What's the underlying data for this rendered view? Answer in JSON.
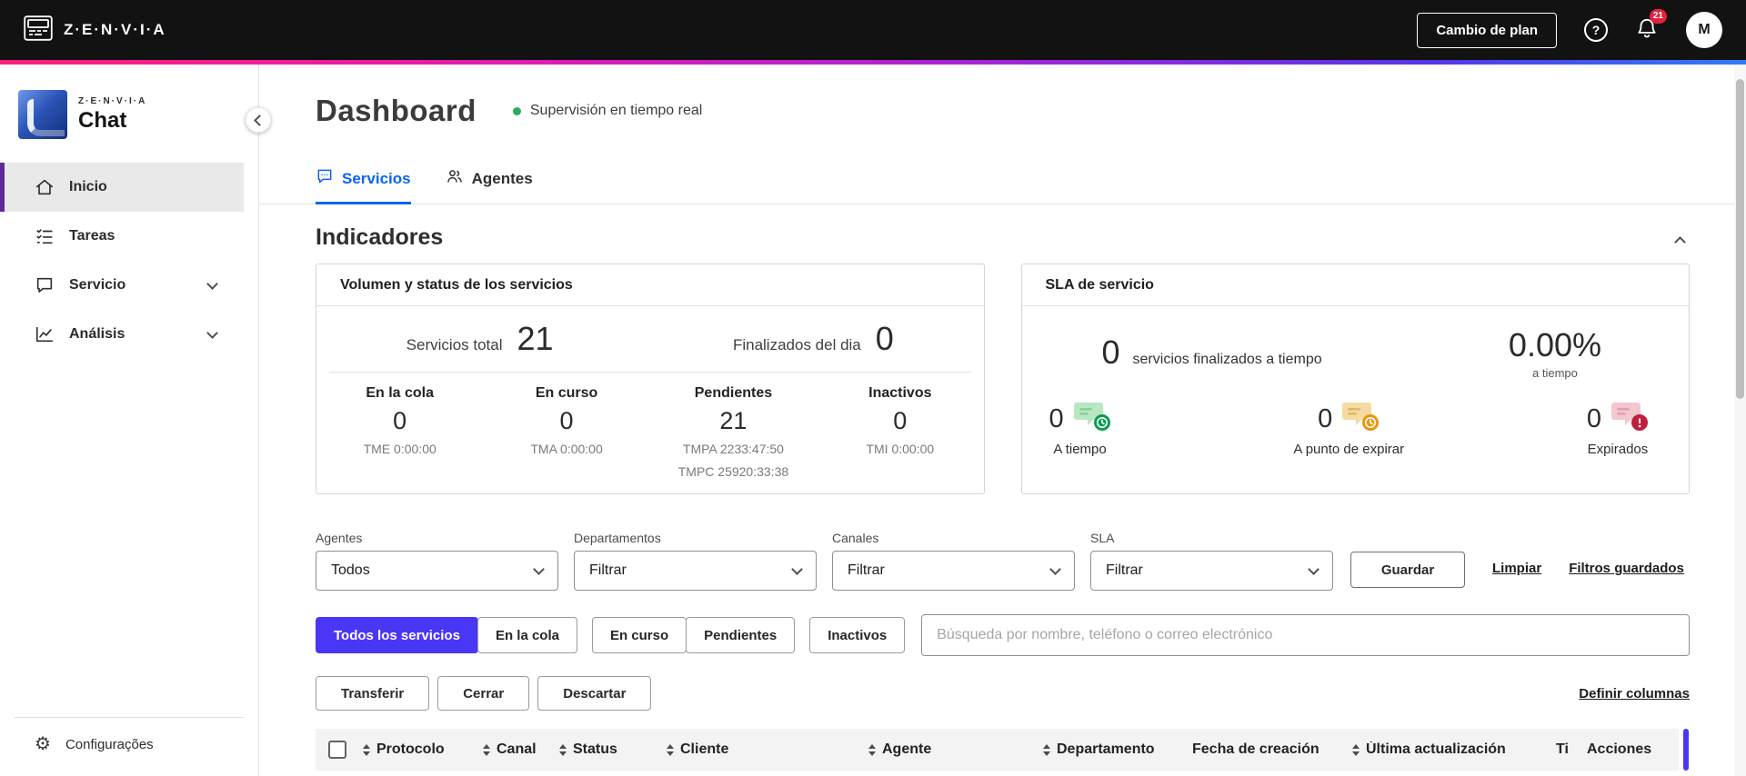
{
  "colors": {
    "accent_purple": "#4a36f5",
    "active_tab_blue": "#0b63f3",
    "sidebar_active_purple": "#5e2b97",
    "realtime_green": "#27ae60",
    "sla_ontime_green": "#0a9d4e",
    "sla_expiring_orange": "#e8960f",
    "sla_expired_red": "#bf1f3f",
    "notification_red": "#e4213f"
  },
  "icons": {
    "help": "?",
    "gear": "⚙"
  },
  "topbar": {
    "brand": "Z·E·N·V·I·A",
    "change_plan_label": "Cambio de plan",
    "notification_count": "21",
    "avatar_initial": "M"
  },
  "sidebar": {
    "logo_brand": "Z·E·N·V·I·A",
    "logo_product": "Chat",
    "items": [
      {
        "label": "Inicio"
      },
      {
        "label": "Tareas"
      },
      {
        "label": "Servicio"
      },
      {
        "label": "Análisis"
      }
    ],
    "footer_item": "Configurações"
  },
  "header": {
    "title": "Dashboard",
    "status_text": "Supervisión en tiempo real"
  },
  "tabs": [
    {
      "label": "Servicios"
    },
    {
      "label": "Agentes"
    }
  ],
  "indicators": {
    "section_title": "Indicadores",
    "volume_card": {
      "title": "Volumen y status de los servicios",
      "totals": [
        {
          "label": "Servicios total",
          "value": "21"
        },
        {
          "label": "Finalizados del dia",
          "value": "0"
        }
      ],
      "stats": [
        {
          "label": "En la cola",
          "value": "0",
          "sub1": "TME 0:00:00",
          "sub2": ""
        },
        {
          "label": "En curso",
          "value": "0",
          "sub1": "TMA 0:00:00",
          "sub2": ""
        },
        {
          "label": "Pendientes",
          "value": "21",
          "sub1": "TMPA 2233:47:50",
          "sub2": "TMPC 25920:33:38"
        },
        {
          "label": "Inactivos",
          "value": "0",
          "sub1": "TMI 0:00:00",
          "sub2": ""
        }
      ]
    },
    "sla_card": {
      "title": "SLA de servicio",
      "finalized_value": "0",
      "finalized_label": "servicios finalizados a tiempo",
      "percent_value": "0.00%",
      "percent_label": "a tiempo",
      "stats": [
        {
          "value": "0",
          "label": "A tiempo"
        },
        {
          "value": "0",
          "label": "A punto de expirar"
        },
        {
          "value": "0",
          "label": "Expirados"
        }
      ]
    }
  },
  "filters": {
    "fields": [
      {
        "label": "Agentes",
        "value": "Todos"
      },
      {
        "label": "Departamentos",
        "value": "Filtrar"
      },
      {
        "label": "Canales",
        "value": "Filtrar"
      },
      {
        "label": "SLA",
        "value": "Filtrar"
      }
    ],
    "save_label": "Guardar",
    "clear_label": "Limpiar",
    "saved_label": "Filtros guardados"
  },
  "service_tabs": [
    {
      "label": "Todos los servicios"
    },
    {
      "label": "En la cola"
    },
    {
      "label": "En curso"
    },
    {
      "label": "Pendientes"
    },
    {
      "label": "Inactivos"
    }
  ],
  "search": {
    "placeholder": "Búsqueda por nombre, teléfono o correo electrónico"
  },
  "bulk_actions": {
    "transfer": "Transferir",
    "close": "Cerrar",
    "discard": "Descartar",
    "define_columns": "Definir columnas"
  },
  "table": {
    "columns": [
      {
        "label": "Protocolo"
      },
      {
        "label": "Canal"
      },
      {
        "label": "Status"
      },
      {
        "label": "Cliente"
      },
      {
        "label": "Agente"
      },
      {
        "label": "Departamento"
      },
      {
        "label": "Fecha de creación"
      },
      {
        "label": "Última actualización"
      },
      {
        "label": "Ti"
      },
      {
        "label": "Acciones"
      }
    ]
  }
}
